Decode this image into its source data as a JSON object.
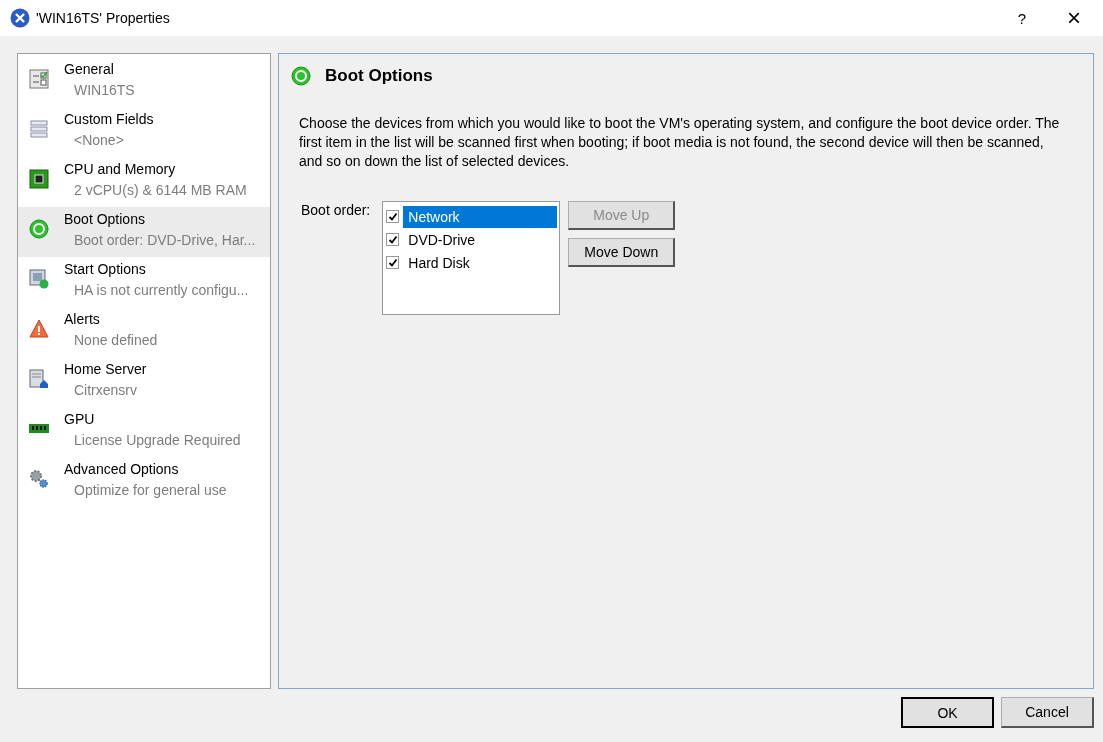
{
  "window": {
    "title": "'WIN16TS' Properties",
    "help": "?",
    "close": "×"
  },
  "sidebar": {
    "items": [
      {
        "kind": "general",
        "title": "General",
        "subtitle": "WIN16TS",
        "selected": false
      },
      {
        "kind": "fields",
        "title": "Custom Fields",
        "subtitle": "<None>",
        "selected": false
      },
      {
        "kind": "cpu",
        "title": "CPU and Memory",
        "subtitle": "2 vCPU(s) & 6144 MB RAM",
        "selected": false
      },
      {
        "kind": "boot",
        "title": "Boot Options",
        "subtitle": "Boot order: DVD-Drive, Har...",
        "selected": true
      },
      {
        "kind": "start",
        "title": "Start Options",
        "subtitle": "HA is not currently configu...",
        "selected": false
      },
      {
        "kind": "alert",
        "title": "Alerts",
        "subtitle": "None defined",
        "selected": false
      },
      {
        "kind": "home",
        "title": "Home Server",
        "subtitle": "Citrxensrv",
        "selected": false
      },
      {
        "kind": "gpu",
        "title": "GPU",
        "subtitle": "License Upgrade Required",
        "selected": false
      },
      {
        "kind": "advanced",
        "title": "Advanced Options",
        "subtitle": "Optimize for general use",
        "selected": false
      }
    ]
  },
  "panel": {
    "heading": "Boot Options",
    "description": "Choose the devices from which you would like to boot the VM's operating system, and configure the boot device order. The first item in the list will be scanned first when booting; if boot media is not found, the second device will then be scanned, and so on down the list of selected devices.",
    "boot_order_label": "Boot order:",
    "devices": [
      {
        "label": "Network",
        "checked": true,
        "selected": true
      },
      {
        "label": "DVD-Drive",
        "checked": true,
        "selected": false
      },
      {
        "label": "Hard Disk",
        "checked": true,
        "selected": false
      }
    ],
    "buttons": [
      {
        "label": "Move Up",
        "disabled": true
      },
      {
        "label": "Move Down",
        "disabled": false
      }
    ]
  },
  "footer": {
    "buttons": [
      {
        "label": "OK",
        "default": true
      },
      {
        "label": "Cancel",
        "default": false
      }
    ]
  }
}
